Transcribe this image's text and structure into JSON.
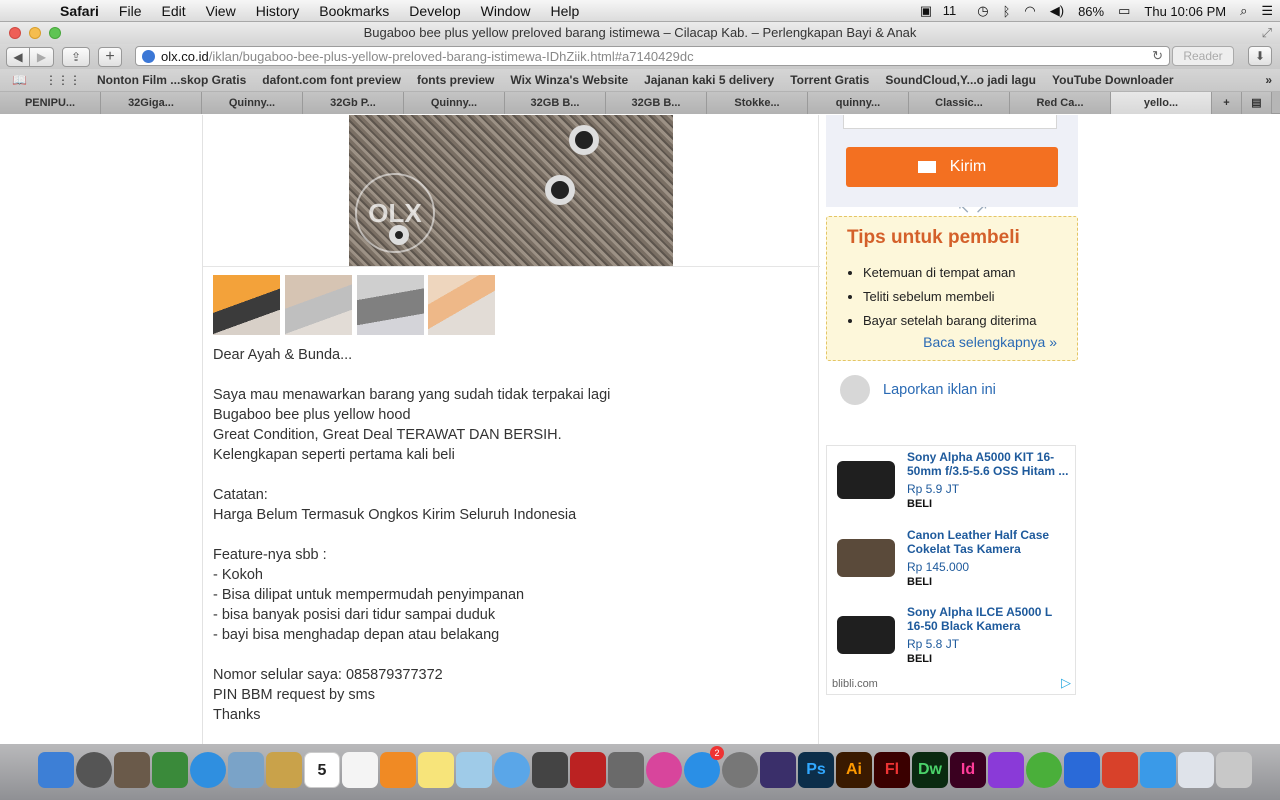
{
  "menubar": {
    "app": "Safari",
    "items": [
      "File",
      "Edit",
      "View",
      "History",
      "Bookmarks",
      "Develop",
      "Window",
      "Help"
    ],
    "status_adobe": "11",
    "battery": "86%",
    "clock": "Thu 10:06 PM"
  },
  "window": {
    "title": "Bugaboo bee plus yellow preloved barang istimewa – Cilacap Kab. – Perlengkapan Bayi & Anak"
  },
  "toolbar": {
    "url_host": "olx.co.id",
    "url_path": "/iklan/bugaboo-bee-plus-yellow-preloved-barang-istimewa-IDhZiik.html#a7140429dc",
    "reader": "Reader"
  },
  "bookmarks": [
    "Nonton Film ...skop Gratis",
    "dafont.com font preview",
    "fonts preview",
    "Wix Winza's Website",
    "Jajanan kaki 5 delivery",
    "Torrent Gratis",
    "SoundCloud,Y...o jadi lagu",
    "YouTube Downloader"
  ],
  "tabs": [
    "PENIPU...",
    "32Giga...",
    "Quinny...",
    "32Gb P...",
    "Quinny...",
    "32GB B...",
    "32GB B...",
    "Stokke...",
    "quinny...",
    "Classic...",
    "Red Ca...",
    "yello..."
  ],
  "listing": {
    "watermark": "OLX",
    "description": [
      "Dear Ayah & Bunda...",
      "",
      "Saya mau menawarkan barang yang sudah tidak terpakai lagi",
      "Bugaboo bee plus yellow hood",
      "Great Condition, Great Deal TERAWAT DAN BERSIH.",
      "Kelengkapan seperti pertama kali beli",
      "",
      "Catatan:",
      "Harga Belum Termasuk Ongkos Kirim Seluruh Indonesia",
      "",
      "Feature-nya sbb :",
      "- Kokoh",
      "- Bisa dilipat untuk mempermudah penyimpanan",
      "- bisa banyak posisi dari tidur sampai duduk",
      "- bayi bisa menghadap depan atau belakang",
      "",
      "Nomor selular saya: 085879377372",
      "PIN BBM request by sms",
      "Thanks"
    ]
  },
  "sidebar": {
    "send_button": "Kirim",
    "tips_title": "Tips untuk pembeli",
    "tips": [
      "Ketemuan di tempat aman",
      "Teliti sebelum membeli",
      "Bayar setelah barang diterima"
    ],
    "tips_more": "Baca selengkapnya »",
    "report": "Laporkan iklan ini"
  },
  "ads": {
    "items": [
      {
        "title": "Sony Alpha A5000 KIT 16-50mm f/3.5-5.6 OSS Hitam ...",
        "price": "Rp 5.9 JT",
        "buy": "BELI"
      },
      {
        "title": "Canon Leather Half Case Cokelat Tas Kamera",
        "price": "Rp 145.000",
        "buy": "BELI"
      },
      {
        "title": "Sony Alpha ILCE A5000 L 16-50 Black Kamera",
        "price": "Rp 5.8 JT",
        "buy": "BELI"
      }
    ],
    "source": "blibli.com"
  },
  "dock": {
    "calendar_day": "5",
    "appstore_badge": "2",
    "icons": [
      "Ps",
      "Ai",
      "Fl",
      "Dw",
      "Id"
    ]
  }
}
